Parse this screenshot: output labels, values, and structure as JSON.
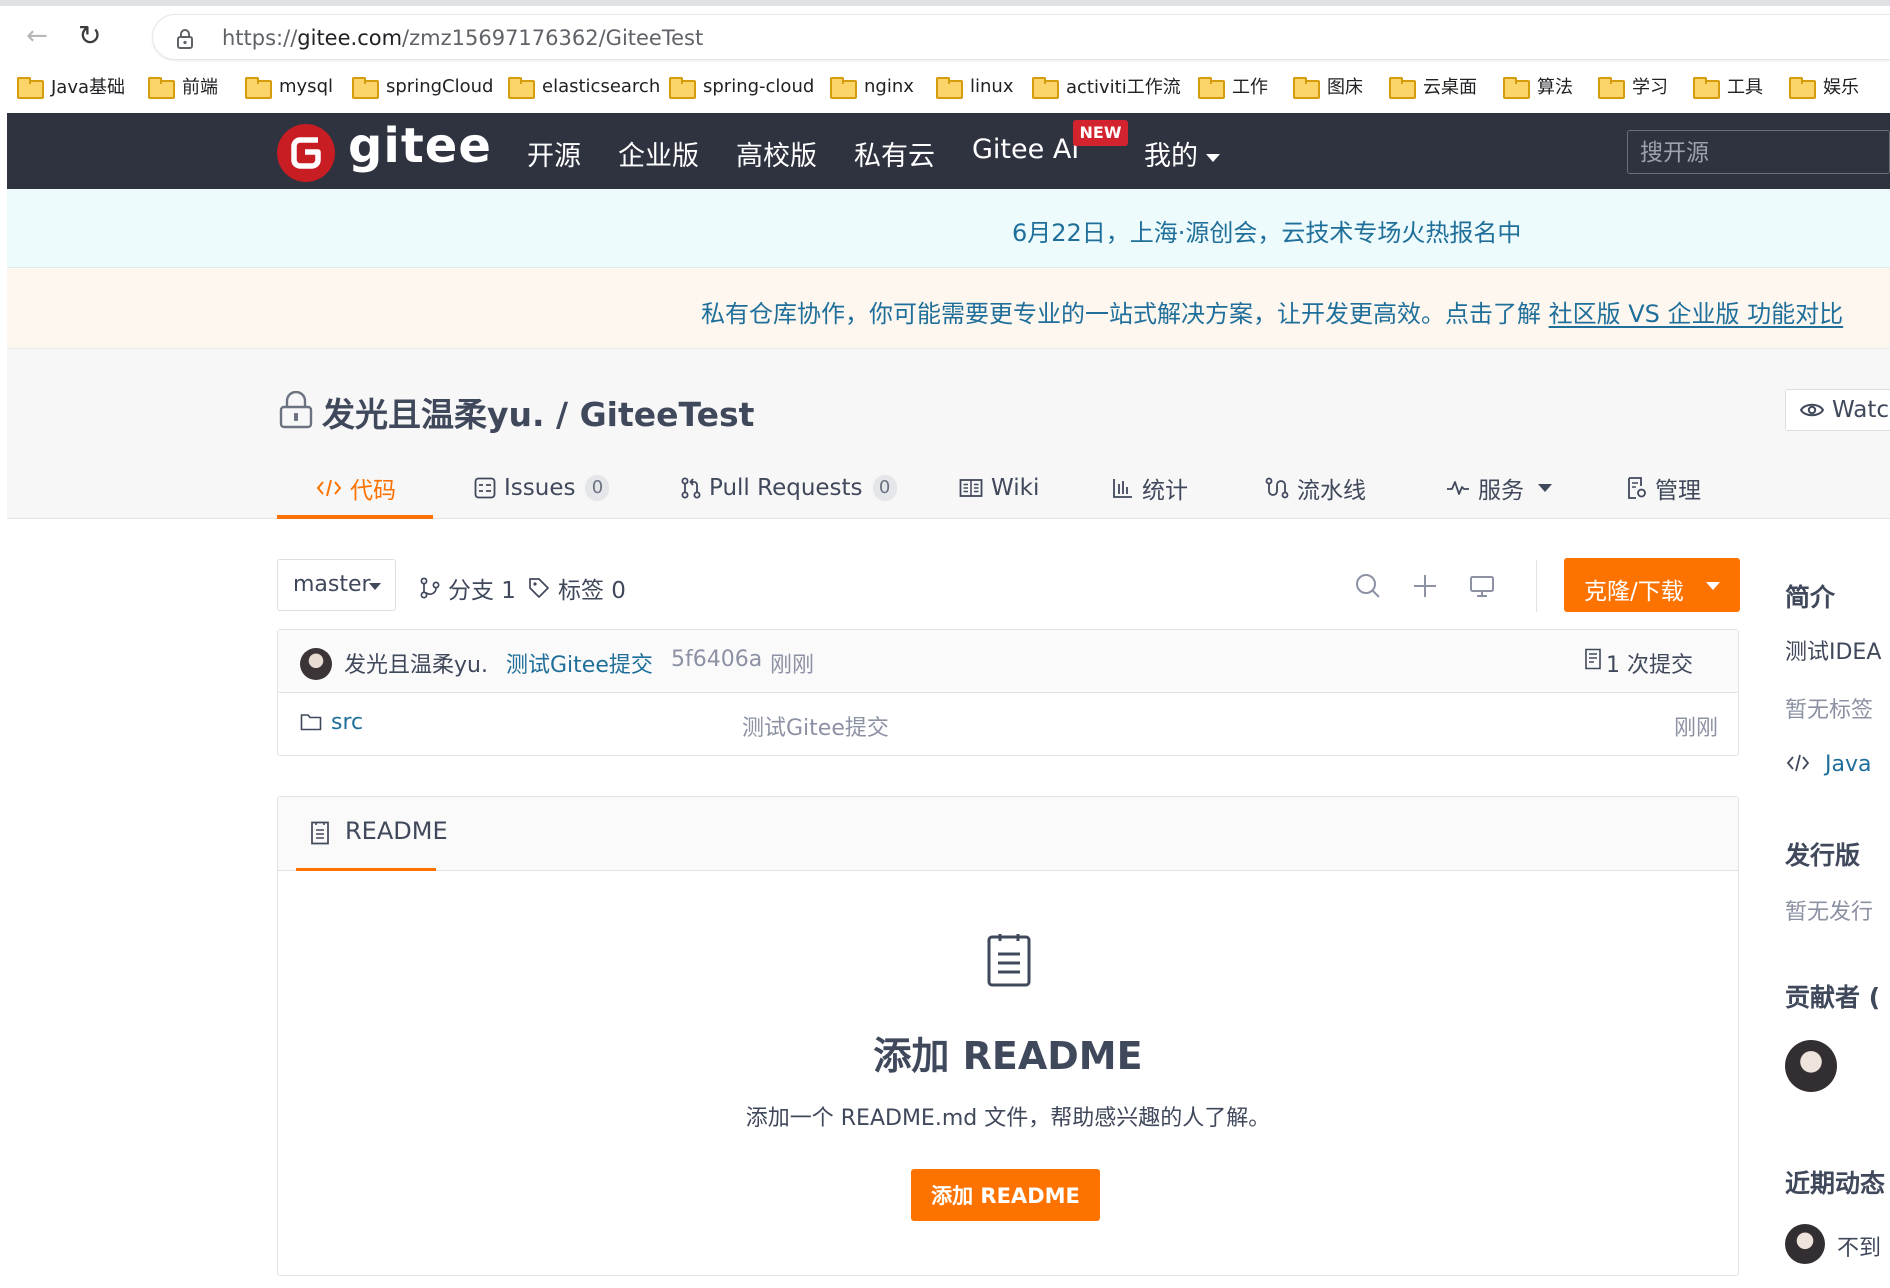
{
  "browser": {
    "url_prefix": "https://",
    "url_domain": "gitee.com",
    "url_path": "/zmz15697176362/GiteeTest",
    "bookmarks": [
      "Java基础",
      "前端",
      "mysql",
      "springCloud",
      "elasticsearch",
      "spring-cloud",
      "nginx",
      "linux",
      "activiti工作流",
      "工作",
      "图床",
      "云桌面",
      "算法",
      "学习",
      "工具",
      "娱乐"
    ]
  },
  "header": {
    "logo_text": "gitee",
    "nav": [
      "开源",
      "企业版",
      "高校版",
      "私有云",
      "Gitee AI",
      "我的"
    ],
    "new_badge": "NEW",
    "search_placeholder": "搜开源"
  },
  "banners": {
    "event": "6月22日，上海·源创会，云技术专场火热报名中",
    "promo_text": "私有仓库协作，你可能需要更专业的一站式解决方案，让开发更高效。点击了解 ",
    "promo_link": "社区版 VS 企业版 功能对比"
  },
  "project": {
    "title": "发光且温柔yu. / GiteeTest",
    "watch_label": "Watc",
    "tabs": [
      {
        "label": "代码",
        "active": true
      },
      {
        "label": "Issues",
        "count": "0"
      },
      {
        "label": "Pull Requests",
        "count": "0"
      },
      {
        "label": "Wiki"
      },
      {
        "label": "统计"
      },
      {
        "label": "流水线"
      },
      {
        "label": "服务"
      },
      {
        "label": "管理"
      }
    ]
  },
  "branchbar": {
    "branch": "master",
    "branches_label": "分支 1",
    "tags_label": "标签 0",
    "clone_label": "克隆/下载"
  },
  "commit": {
    "author": "发光且温柔yu.",
    "message": "测试Gitee提交",
    "sha": "5f6406a",
    "time": "刚刚",
    "count_label": "1 次提交"
  },
  "files": [
    {
      "name": "src",
      "message": "测试Gitee提交",
      "time": "刚刚"
    }
  ],
  "readme": {
    "tab_label": "README",
    "heading": "添加 README",
    "desc": "添加一个 README.md 文件，帮助感兴趣的人了解。",
    "button": "添加 README"
  },
  "sidebar": {
    "intro_title": "简介",
    "intro_text": "测试IDEA",
    "no_tags": "暂无标签",
    "language": "Java",
    "release_title": "发行版",
    "no_release": "暂无发行",
    "contrib_title": "贡献者 (",
    "activity_title": "近期动态",
    "activity_item": "不到"
  },
  "colors": {
    "accent": "#fe7300",
    "header_bg": "#2f3340",
    "link": "#1f6f9a",
    "logo_red": "#c71d23"
  }
}
